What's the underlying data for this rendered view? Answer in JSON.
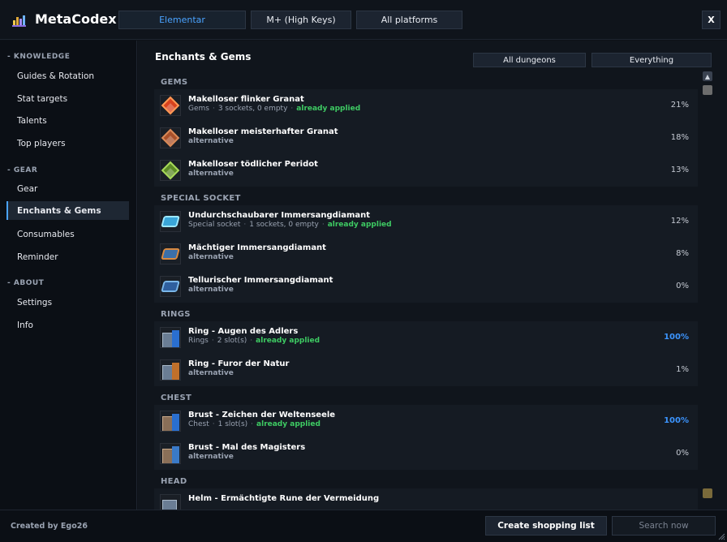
{
  "app": {
    "title": "MetaCodex",
    "close_label": "X"
  },
  "topbar": {
    "tabs": [
      {
        "label": "Elementar",
        "active": true
      },
      {
        "label": "M+ (High Keys)",
        "active": false
      },
      {
        "label": "All platforms",
        "active": false
      }
    ]
  },
  "sidebar": {
    "sections": [
      {
        "title": "-   KNOWLEDGE",
        "items": [
          "Guides & Rotation",
          "Stat targets",
          "Talents",
          "Top players"
        ]
      },
      {
        "title": "-   GEAR",
        "items": [
          "Gear",
          "Enchants & Gems",
          "Consumables",
          "Reminder"
        ]
      },
      {
        "title": "-   ABOUT",
        "items": [
          "Settings",
          "Info"
        ]
      }
    ],
    "active_item": "Enchants & Gems"
  },
  "main": {
    "title": "Enchants & Gems",
    "filters": [
      "All dungeons",
      "Everything"
    ],
    "groups": [
      {
        "title": "GEMS",
        "rows": [
          {
            "name": "Makelloser flinker Granat",
            "category": "Gems",
            "detail": "3 sockets, 0 empty",
            "status": "already applied",
            "pct": "21%"
          },
          {
            "name": "Makelloser meisterhafter Granat",
            "sub": "alternative",
            "pct": "18%"
          },
          {
            "name": "Makelloser tödlicher Peridot",
            "sub": "alternative",
            "pct": "13%"
          }
        ]
      },
      {
        "title": "SPECIAL SOCKET",
        "rows": [
          {
            "name": "Undurchschaubarer Immersangdiamant",
            "category": "Special socket",
            "detail": "1 sockets, 0 empty",
            "status": "already applied",
            "pct": "12%"
          },
          {
            "name": "Mächtiger Immersangdiamant",
            "sub": "alternative",
            "pct": "8%"
          },
          {
            "name": "Tellurischer Immersangdiamant",
            "sub": "alternative",
            "pct": "0%"
          }
        ]
      },
      {
        "title": "RINGS",
        "rows": [
          {
            "name": "Ring - Augen des Adlers",
            "category": "Rings",
            "detail": "2 slot(s)",
            "status": "already applied",
            "pct": "100%"
          },
          {
            "name": "Ring - Furor der Natur",
            "sub": "alternative",
            "pct": "1%"
          }
        ]
      },
      {
        "title": "CHEST",
        "rows": [
          {
            "name": "Brust - Zeichen der Weltenseele",
            "category": "Chest",
            "detail": "1 slot(s)",
            "status": "already applied",
            "pct": "100%"
          },
          {
            "name": "Brust - Mal des Magisters",
            "sub": "alternative",
            "pct": "0%"
          }
        ]
      },
      {
        "title": "HEAD",
        "rows": [
          {
            "name": "Helm - Ermächtigte Rune der Vermeidung"
          }
        ]
      }
    ]
  },
  "footer": {
    "credit": "Created by Ego26",
    "shopping_label": "Create shopping list",
    "search_label": "Search now"
  },
  "colors": {
    "accent": "#4aa3ff",
    "applied": "#3ecb63",
    "full_pct": "#3c95ff",
    "background": "#10151c"
  },
  "icons": [
    "chart-logo-icon",
    "red-gem-icon",
    "orange-gem-icon",
    "green-gem-icon",
    "blue-diamond-icon",
    "scroll-icon"
  ]
}
